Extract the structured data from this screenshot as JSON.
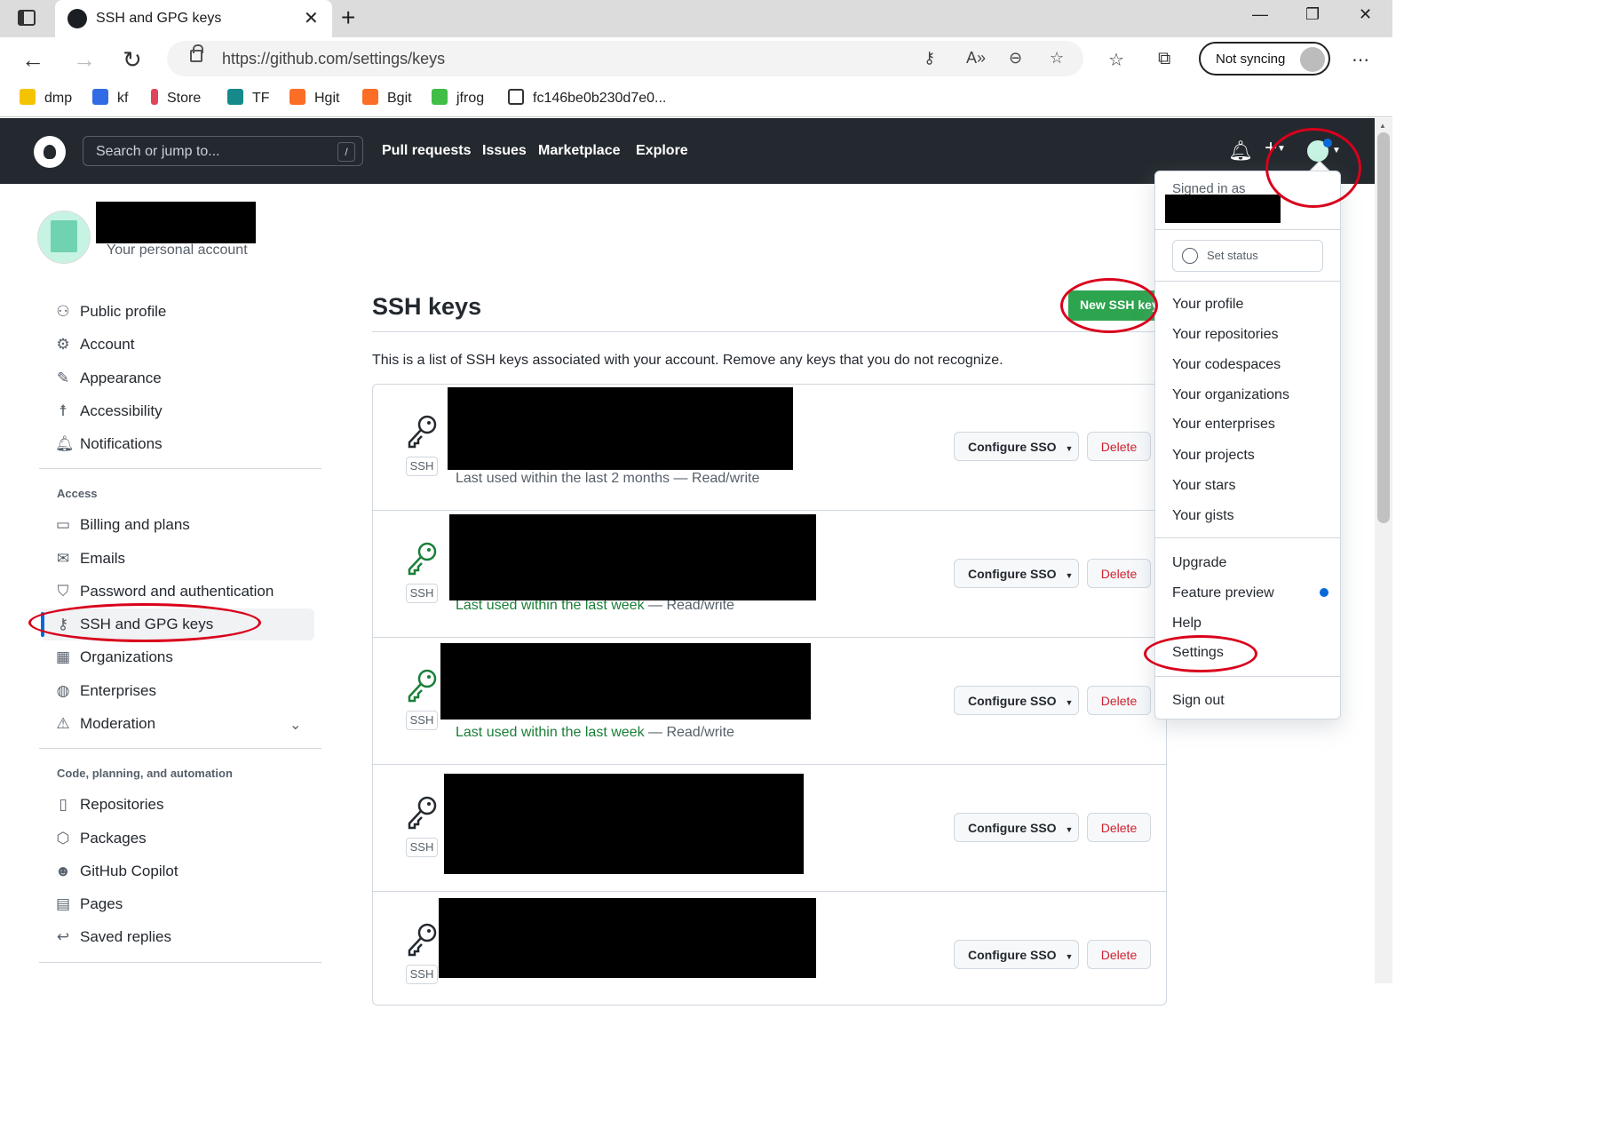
{
  "browser": {
    "tab_title": "SSH and GPG keys",
    "url": "https://github.com/settings/keys",
    "sync_label": "Not syncing",
    "bookmarks": [
      "dmp",
      "kf",
      "Store",
      "TF",
      "Hgit",
      "Bgit",
      "jfrog",
      "fc146be0b230d7e0..."
    ]
  },
  "github_header": {
    "search_placeholder": "Search or jump to...",
    "search_shortcut": "/",
    "nav": [
      "Pull requests",
      "Issues",
      "Marketplace",
      "Explore"
    ],
    "plus": "+"
  },
  "profile": {
    "subtitle": "Your personal account"
  },
  "sidebar": {
    "top_items": [
      {
        "label": "Public profile",
        "icon": "person-icon"
      },
      {
        "label": "Account",
        "icon": "gear-icon"
      },
      {
        "label": "Appearance",
        "icon": "paintbrush-icon"
      },
      {
        "label": "Accessibility",
        "icon": "accessibility-icon"
      },
      {
        "label": "Notifications",
        "icon": "bell-icon"
      }
    ],
    "access_heading": "Access",
    "access_items": [
      {
        "label": "Billing and plans",
        "icon": "credit-card-icon"
      },
      {
        "label": "Emails",
        "icon": "mail-icon"
      },
      {
        "label": "Password and authentication",
        "icon": "shield-lock-icon"
      },
      {
        "label": "SSH and GPG keys",
        "icon": "key-icon",
        "active": true
      },
      {
        "label": "Organizations",
        "icon": "organization-icon"
      },
      {
        "label": "Enterprises",
        "icon": "globe-icon"
      },
      {
        "label": "Moderation",
        "icon": "report-icon"
      }
    ],
    "code_heading": "Code, planning, and automation",
    "code_items": [
      {
        "label": "Repositories",
        "icon": "repo-icon"
      },
      {
        "label": "Packages",
        "icon": "package-icon"
      },
      {
        "label": "GitHub Copilot",
        "icon": "copilot-icon"
      },
      {
        "label": "Pages",
        "icon": "browser-icon"
      },
      {
        "label": "Saved replies",
        "icon": "reply-icon"
      }
    ]
  },
  "main": {
    "title": "SSH keys",
    "new_button": "New SSH key",
    "description": "This is a list of SSH keys associated with your account. Remove any keys that you do not recognize.",
    "keys": [
      {
        "type_label": "SSH",
        "last_used_prefix": "Last used within the last 2 months",
        "access": "Read/write",
        "recent": false,
        "configure": "Configure SSO",
        "delete": "Delete"
      },
      {
        "type_label": "SSH",
        "last_used_prefix": "Last used within the last week",
        "access": "Read/write",
        "recent": true,
        "configure": "Configure SSO",
        "delete": "Delete"
      },
      {
        "type_label": "SSH",
        "last_used_prefix": "Last used within the last week",
        "access": "Read/write",
        "recent": true,
        "configure": "Configure SSO",
        "delete": "Delete"
      },
      {
        "type_label": "SSH",
        "last_used_prefix": "",
        "access": "",
        "recent": false,
        "configure": "Configure SSO",
        "delete": "Delete"
      },
      {
        "type_label": "SSH",
        "last_used_prefix": "",
        "access": "",
        "recent": false,
        "configure": "Configure SSO",
        "delete": "Delete"
      }
    ],
    "separator": " — "
  },
  "user_menu": {
    "signed_in_as": "Signed in as",
    "set_status": "Set status",
    "group1": [
      "Your profile",
      "Your repositories",
      "Your codespaces",
      "Your organizations",
      "Your enterprises",
      "Your projects",
      "Your stars",
      "Your gists"
    ],
    "group2": [
      "Upgrade",
      "Feature preview",
      "Help",
      "Settings"
    ],
    "sign_out": "Sign out"
  },
  "colors": {
    "header_bg": "#24292f",
    "primary_green": "#2da44e",
    "danger_red": "#cf222e",
    "annotation_red": "#d9001b",
    "link_blue": "#0969da"
  }
}
